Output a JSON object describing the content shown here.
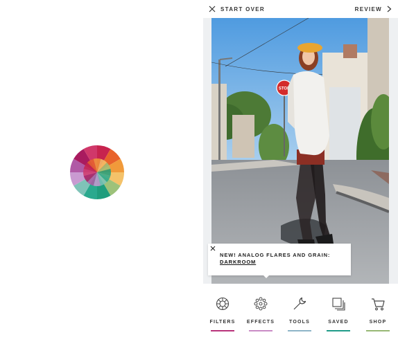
{
  "header": {
    "start_over_label": "START OVER",
    "review_label": "REVIEW"
  },
  "photo": {
    "sign_text": "STOP"
  },
  "toast": {
    "message": "NEW! ANALOG FLARES AND GRAIN:",
    "link_label": "DARKROOM"
  },
  "toolbar": {
    "items": [
      {
        "label": "FILTERS",
        "icon": "filters-icon",
        "color": "#b8327a"
      },
      {
        "label": "EFFECTS",
        "icon": "effects-icon",
        "color": "#c98bc5"
      },
      {
        "label": "TOOLS",
        "icon": "tools-icon",
        "color": "#8db4c7"
      },
      {
        "label": "SAVED",
        "icon": "saved-icon",
        "color": "#1f9b88"
      },
      {
        "label": "SHOP",
        "icon": "shop-icon",
        "color": "#97b874"
      }
    ]
  },
  "logo": {
    "colors": [
      "#c7234e",
      "#e8632b",
      "#f19a3a",
      "#f4c26a",
      "#9dc27a",
      "#1f9d7d",
      "#2aa98e",
      "#7fc3b8",
      "#c99ad1",
      "#b05aa6",
      "#a91b5f",
      "#d0386a"
    ]
  }
}
